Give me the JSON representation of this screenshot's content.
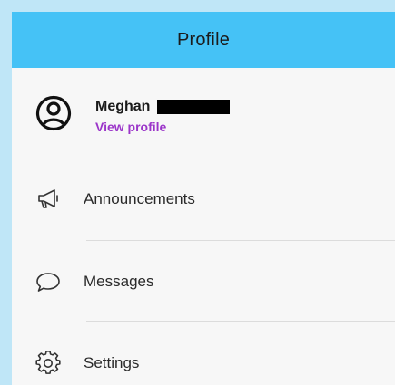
{
  "header": {
    "title": "Profile"
  },
  "profile": {
    "name": "Meghan",
    "view_profile_label": "View profile"
  },
  "menu": [
    {
      "label": "Announcements",
      "icon": "megaphone-icon"
    },
    {
      "label": "Messages",
      "icon": "chat-bubble-icon"
    },
    {
      "label": "Settings",
      "icon": "gear-icon"
    }
  ],
  "colors": {
    "header_bg": "#45c2f6",
    "outer_bg": "#bfe6f7",
    "panel_bg": "#f7f7f7",
    "link": "#9b35c9"
  }
}
